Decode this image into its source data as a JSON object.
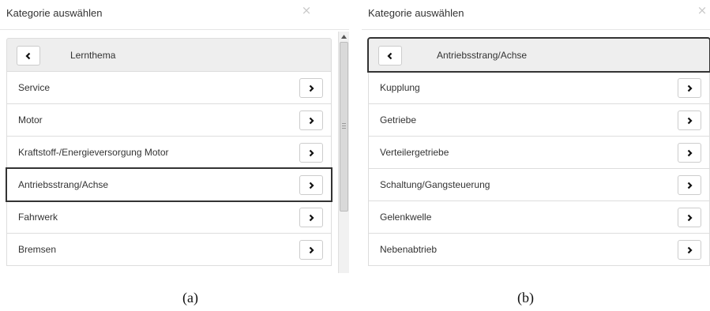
{
  "panel_a": {
    "title": "Kategorie auswählen",
    "close_glyph": "×",
    "breadcrumb": "Lernthema",
    "items": [
      {
        "label": "Service"
      },
      {
        "label": "Motor"
      },
      {
        "label": "Kraftstoff-/Energieversorgung Motor"
      },
      {
        "label": "Antriebsstrang/Achse"
      },
      {
        "label": "Fahrwerk"
      },
      {
        "label": "Bremsen"
      }
    ],
    "highlighted_item": "Antriebsstrang/Achse",
    "caption": "(a)"
  },
  "panel_b": {
    "title": "Kategorie auswählen",
    "close_glyph": "×",
    "breadcrumb": "Antriebsstrang/Achse",
    "items": [
      {
        "label": "Kupplung"
      },
      {
        "label": "Getriebe"
      },
      {
        "label": "Verteilergetriebe"
      },
      {
        "label": "Schaltung/Gangsteuerung"
      },
      {
        "label": "Gelenkwelle"
      },
      {
        "label": "Nebenabtrieb"
      }
    ],
    "highlighted_item": "Antriebsstrang/Achse",
    "caption": "(b)"
  },
  "icons": {
    "back": "chevron-left-icon",
    "forward": "chevron-right-icon",
    "close": "close-icon",
    "scroll_up": "scroll-up-arrow-icon"
  },
  "colors": {
    "header_bg": "#eeeeee",
    "border": "#dddddd",
    "highlight_border": "#333333",
    "close_icon": "#c8c8c8"
  }
}
